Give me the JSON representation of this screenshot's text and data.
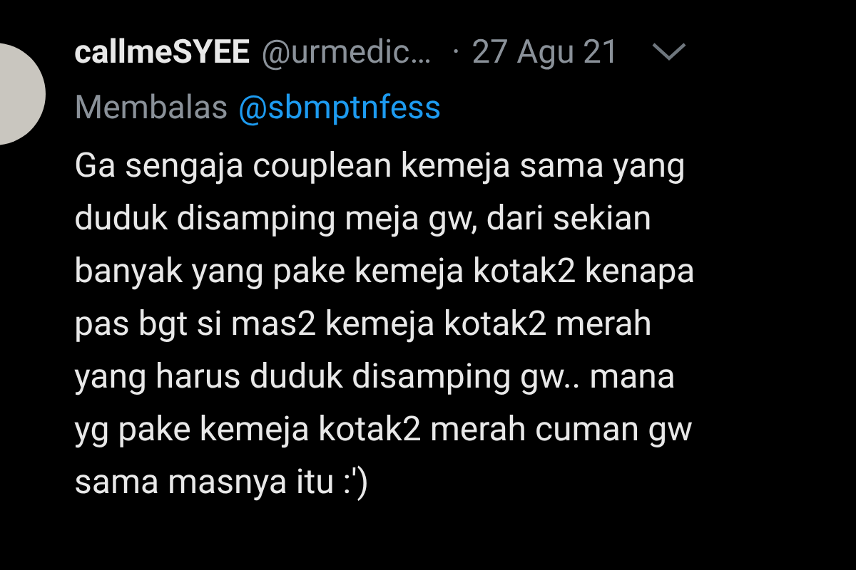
{
  "tweet": {
    "display_name": "callmeSYEE",
    "handle": "@urmedic…",
    "separator": "·",
    "date": "27 Agu 21",
    "reply_label": "Membalas",
    "reply_to": "@sbmptnfess",
    "text": "Ga sengaja couplean kemeja sama yang\nduduk disamping meja gw, dari sekian\nbanyak yang pake kemeja kotak2 kenapa\npas bgt si mas2 kemeja kotak2 merah\nyang harus duduk disamping gw.. mana\nyg pake kemeja kotak2 merah cuman gw\nsama masnya itu :')"
  }
}
